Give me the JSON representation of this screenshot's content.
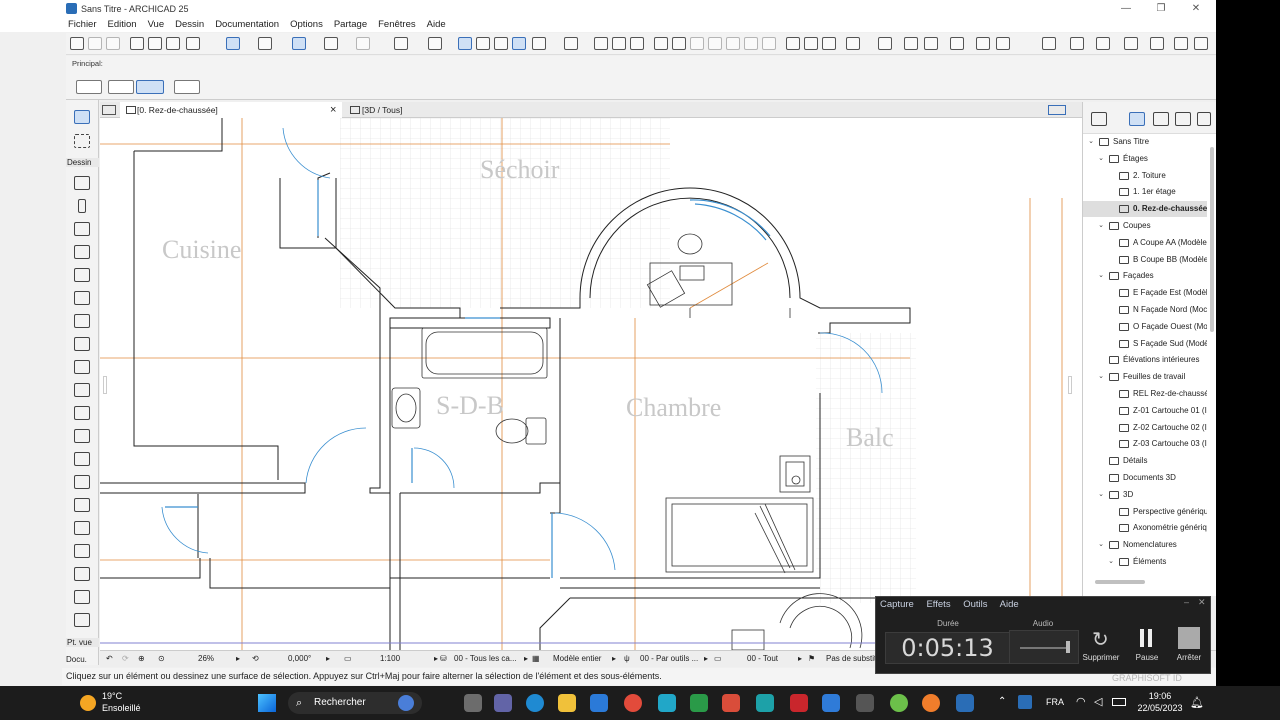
{
  "window": {
    "title": "Sans Titre - ARCHICAD 25"
  },
  "menu": [
    "Fichier",
    "Edition",
    "Vue",
    "Dessin",
    "Documentation",
    "Options",
    "Partage",
    "Fenêtres",
    "Aide"
  ],
  "infobox": {
    "label": "Principal:"
  },
  "toolbox": {
    "section_dessin": "Dessin",
    "footer": "Pt. vue",
    "footer2": "Docu."
  },
  "tabs": [
    {
      "label": "[0. Rez-de-chaussée]",
      "close": "×"
    },
    {
      "label": "[3D / Tous]"
    }
  ],
  "plan": {
    "rooms": [
      "Séchoir",
      "Cuisine",
      "S-D-B",
      "Chambre",
      "Balc"
    ]
  },
  "statusbar": {
    "zoom": "26%",
    "angle": "0,000°",
    "scale": "1:100",
    "layers": "00 - Tous les ca...",
    "model": "Modèle entier",
    "override": "00 - Par outils ...",
    "struct": "00 - Tout",
    "renov": "Pas de substit"
  },
  "message": "Cliquez sur un élément ou dessinez une surface de sélection. Appuyez sur Ctrl+Maj pour faire alterner la sélection de l'élément et des sous-éléments.",
  "navigator": {
    "rows": [
      {
        "label": "Sans Titre",
        "level": 0,
        "twisty": "⌄"
      },
      {
        "label": "Étages",
        "level": 1,
        "twisty": "⌄"
      },
      {
        "label": "2. Toiture",
        "level": 2
      },
      {
        "label": "1. 1er étage",
        "level": 2
      },
      {
        "label": "0. Rez-de-chaussée",
        "level": 2,
        "selected": true
      },
      {
        "label": "Coupes",
        "level": 1,
        "twisty": "⌄"
      },
      {
        "label": "A Coupe AA (Modèle",
        "level": 2
      },
      {
        "label": "B Coupe BB (Modèle",
        "level": 2
      },
      {
        "label": "Façades",
        "level": 1,
        "twisty": "⌄"
      },
      {
        "label": "E Façade Est (Modèle",
        "level": 2
      },
      {
        "label": "N Façade Nord (Moc",
        "level": 2
      },
      {
        "label": "O Façade Ouest (Mo",
        "level": 2
      },
      {
        "label": "S Façade Sud (Modèl",
        "level": 2
      },
      {
        "label": "Élévations intérieures",
        "level": 1
      },
      {
        "label": "Feuilles de travail",
        "level": 1,
        "twisty": "⌄"
      },
      {
        "label": "REL Rez-de-chaussée",
        "level": 2
      },
      {
        "label": "Z-01 Cartouche 01 (Ir",
        "level": 2
      },
      {
        "label": "Z-02 Cartouche 02 (Ir",
        "level": 2
      },
      {
        "label": "Z-03 Cartouche 03 (Ir",
        "level": 2
      },
      {
        "label": "Détails",
        "level": 1
      },
      {
        "label": "Documents 3D",
        "level": 1
      },
      {
        "label": "3D",
        "level": 1,
        "twisty": "⌄"
      },
      {
        "label": "Perspective générique",
        "level": 2
      },
      {
        "label": "Axonométrie génériq",
        "level": 2
      },
      {
        "label": "Nomenclatures",
        "level": 1,
        "twisty": "⌄"
      },
      {
        "label": "Éléments",
        "level": 2,
        "twisty": "⌄"
      }
    ]
  },
  "capture": {
    "menu": [
      "Capture",
      "Effets",
      "Outils",
      "Aide"
    ],
    "duration_label": "Durée",
    "duration": "0:05:13",
    "audio_label": "Audio",
    "buttons": [
      "Supprimer",
      "Pause",
      "Arrêter"
    ],
    "watermark": "GRAPHISOFT ID"
  },
  "taskbar": {
    "temp": "19°C",
    "weather": "Ensoleillé",
    "search": "Rechercher",
    "lang": "FRA",
    "time": "19:06",
    "date": "22/05/2023"
  }
}
